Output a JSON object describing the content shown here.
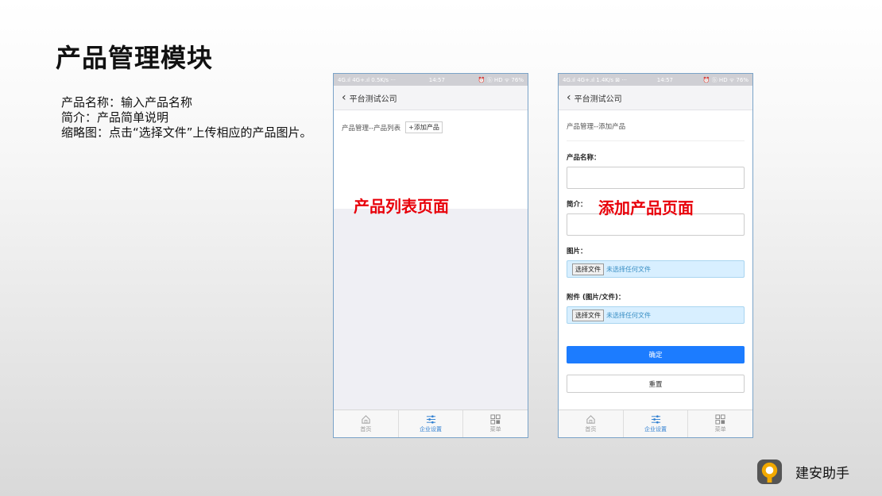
{
  "slide": {
    "title": "产品管理模块",
    "description": [
      "产品名称：输入产品名称",
      "简介：产品简单说明",
      "缩略图：点击“选择文件”上传相应的产品图片。"
    ],
    "brand": "建安助手"
  },
  "phone_list": {
    "status": {
      "left": "4G.ıl 4G+.ıl 0.5K/s ···",
      "time": "14:57",
      "right": "⏰ ⓑ HD ᯤ 76%"
    },
    "nav_title": "平台测试公司",
    "breadcrumb": "产品管理--产品列表",
    "add_button": "+添加产品",
    "overlay_label": "产品列表页面",
    "tabs": [
      {
        "label": "首页",
        "active": false
      },
      {
        "label": "企业设置",
        "active": true
      },
      {
        "label": "菜单",
        "active": false
      }
    ]
  },
  "phone_add": {
    "status": {
      "left": "4G.ıl 4G+.ıl 1.4K/s ⊠ ···",
      "time": "14:57",
      "right": "⏰ ⓑ HD ᯤ 76%"
    },
    "nav_title": "平台测试公司",
    "breadcrumb": "产品管理--添加产品",
    "fields": {
      "name_label": "产品名称：",
      "intro_label": "简介：",
      "image_label": "图片：",
      "attachment_label": "附件 (图片/文件)："
    },
    "file_button": "选择文件",
    "file_none": "未选择任何文件",
    "confirm": "确定",
    "reset": "重置",
    "overlay_label": "添加产品页面",
    "tabs": [
      {
        "label": "首页",
        "active": false
      },
      {
        "label": "企业设置",
        "active": true
      },
      {
        "label": "菜单",
        "active": false
      }
    ]
  },
  "colors": {
    "accent": "#1c7cff",
    "overlay_red": "#e8000a",
    "tab_active": "#2f7fd1"
  }
}
